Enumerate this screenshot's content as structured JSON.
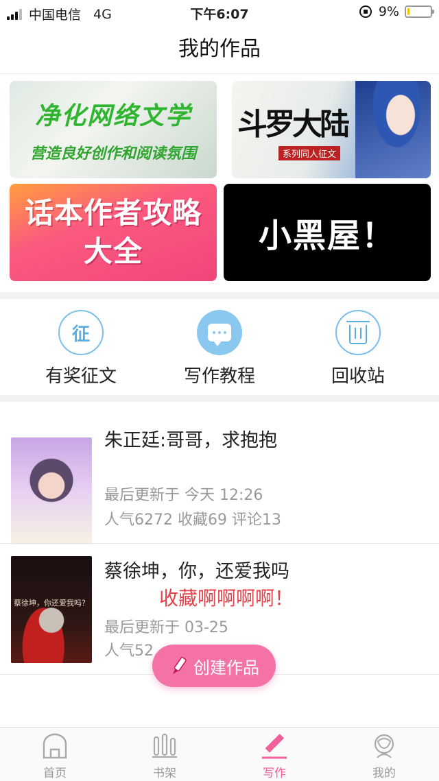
{
  "status_bar": {
    "carrier": "中国电信",
    "network": "4G",
    "time": "下午6:07",
    "battery": "9%",
    "battery_level": 0.09
  },
  "nav": {
    "title": "我的作品"
  },
  "banners": [
    {
      "line1": "净化网络文学",
      "line2": "营造良好创作和阅读氛围"
    },
    {
      "line1": "斗罗大陆",
      "line2": "系列同人征文"
    },
    {
      "line1": "话本作者攻略",
      "line2": "大全"
    },
    {
      "line1": "小黑屋！"
    }
  ],
  "quick_actions": [
    {
      "label": "有奖征文",
      "icon": "contest-icon",
      "glyph": "征"
    },
    {
      "label": "写作教程",
      "icon": "chat-bubble-icon"
    },
    {
      "label": "回收站",
      "icon": "trash-icon"
    }
  ],
  "works": [
    {
      "title": "朱正廷:哥哥，求抱抱",
      "updated": "最后更新于 今天 12:26",
      "stats": "人气6272 收藏69 评论13",
      "tag": ""
    },
    {
      "title": "蔡徐坤，你，还爱我吗",
      "updated": "最后更新于 03-25",
      "stats": "人气52…",
      "tag": "收藏啊啊啊啊！",
      "cover_text": "蔡徐坤，你还爱我吗？"
    }
  ],
  "create_button": {
    "label": "创建作品"
  },
  "tab_bar": [
    {
      "label": "首页",
      "icon": "home-icon",
      "active": false
    },
    {
      "label": "书架",
      "icon": "bookshelf-icon",
      "active": false
    },
    {
      "label": "写作",
      "icon": "pencil-icon",
      "active": true
    },
    {
      "label": "我的",
      "icon": "profile-icon",
      "active": false
    }
  ],
  "colors": {
    "accent": "#f0609a",
    "icon_blue": "#5aaee0",
    "tag_red": "#e6404a",
    "battery": "#f5c400"
  }
}
